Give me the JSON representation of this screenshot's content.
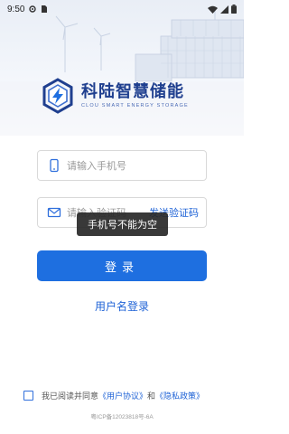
{
  "status_bar": {
    "time": "9:50"
  },
  "brand": {
    "name_cn": "科陆智慧储能",
    "name_en": "CLOU SMART ENERGY STORAGE"
  },
  "form": {
    "phone_placeholder": "请输入手机号",
    "code_placeholder": "请输入验证码",
    "send_code_label": "发送验证码",
    "login_label": "登录",
    "username_login_label": "用户名登录"
  },
  "toast": {
    "message": "手机号不能为空"
  },
  "agreement": {
    "prefix": "我已阅读并同意",
    "user_agreement": "《用户协议》",
    "conjunction": "和",
    "privacy_policy": "《隐私政策》"
  },
  "footer": {
    "icp": "粤ICP备12023818号-6A"
  },
  "colors": {
    "accent": "#1e6fe0",
    "link": "#1e62d6",
    "brand": "#1f3f8f"
  }
}
